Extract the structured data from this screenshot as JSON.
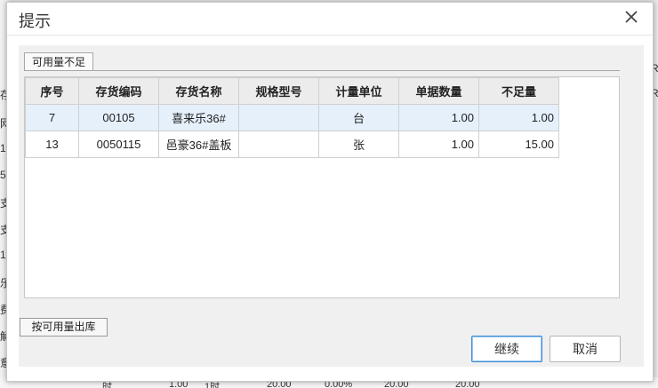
{
  "background": {
    "left_chars": [
      "存",
      "网",
      "1",
      "53",
      "支",
      "支",
      "1",
      "乐",
      "费",
      "解",
      "意"
    ],
    "right_chars": [
      "R",
      "R"
    ],
    "bottom_cells": [
      "时",
      "1.00",
      "1时",
      "20.00",
      "0.00%",
      "20.00",
      "20.00"
    ]
  },
  "dialog": {
    "title": "提示",
    "close_icon": "close-icon",
    "tab_label": "可用量不足",
    "columns": [
      "序号",
      "存货编码",
      "存货名称",
      "规格型号",
      "计量单位",
      "单据数量",
      "不足量"
    ],
    "rows": [
      [
        "7",
        "00105",
        "喜来乐36#",
        "",
        "台",
        "1.00",
        "1.00"
      ],
      [
        "13",
        "0050115",
        "邑豪36#盖板",
        "",
        "张",
        "1.00",
        "15.00"
      ]
    ],
    "selected_row": 0,
    "available_qty_button": "按可用量出库",
    "continue_button": "继续",
    "cancel_button": "取消"
  },
  "colors": {
    "selected_row": "#e5f0fb",
    "primary_border": "#3c8bd8",
    "header_bg": "#ececec"
  }
}
